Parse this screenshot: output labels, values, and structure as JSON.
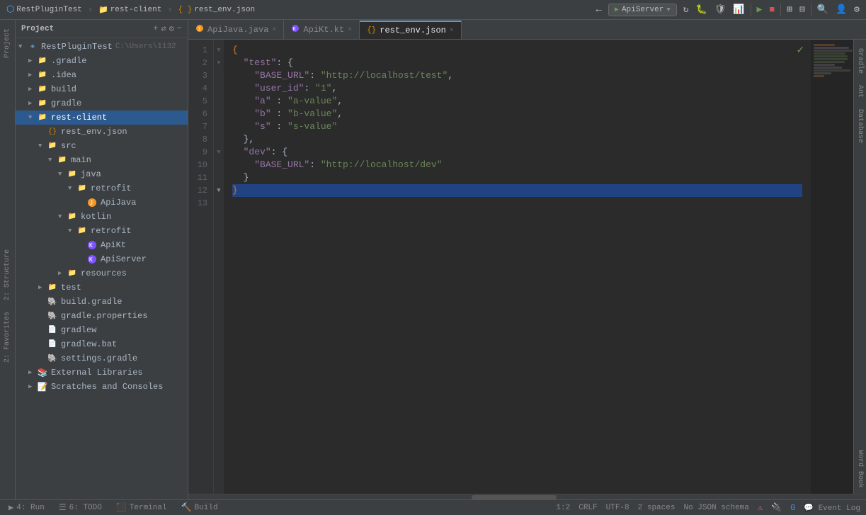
{
  "app": {
    "title": "RestPluginTest",
    "breadcrumb": [
      "RestPluginTest",
      "rest-client",
      "rest_env.json"
    ]
  },
  "toolbar": {
    "project_label": "RestPluginTest",
    "run_config": "ApiServer",
    "buttons": [
      "navigate-back",
      "navigate-forward",
      "add-icon",
      "sync-icon",
      "settings-icon",
      "minimize-icon"
    ]
  },
  "tabs": [
    {
      "id": "ApiJava",
      "label": "ApiJava.java",
      "active": false,
      "modified": false
    },
    {
      "id": "ApiKt",
      "label": "ApiKt.kt",
      "active": false,
      "modified": false
    },
    {
      "id": "rest_env",
      "label": "rest_env.json",
      "active": true,
      "modified": false
    }
  ],
  "sidebar": {
    "title": "Project",
    "items": [
      {
        "id": "root",
        "label": "RestPluginTest",
        "path": "C:\\Users\\1132",
        "indent": 0,
        "expanded": true,
        "type": "module"
      },
      {
        "id": "gradle-root",
        "label": ".gradle",
        "indent": 1,
        "expanded": false,
        "type": "folder"
      },
      {
        "id": "idea",
        "label": ".idea",
        "indent": 1,
        "expanded": false,
        "type": "folder"
      },
      {
        "id": "build-root",
        "label": "build",
        "indent": 1,
        "expanded": false,
        "type": "folder",
        "selected": false
      },
      {
        "id": "gradle",
        "label": "gradle",
        "indent": 1,
        "expanded": false,
        "type": "folder"
      },
      {
        "id": "rest-client",
        "label": "rest-client",
        "indent": 1,
        "expanded": true,
        "type": "folder",
        "selected": true
      },
      {
        "id": "rest_env_json",
        "label": "rest_env.json",
        "indent": 2,
        "expanded": false,
        "type": "json"
      },
      {
        "id": "src",
        "label": "src",
        "indent": 2,
        "expanded": true,
        "type": "folder"
      },
      {
        "id": "main",
        "label": "main",
        "indent": 3,
        "expanded": true,
        "type": "folder"
      },
      {
        "id": "java",
        "label": "java",
        "indent": 4,
        "expanded": true,
        "type": "folder"
      },
      {
        "id": "retrofit-java",
        "label": "retrofit",
        "indent": 5,
        "expanded": true,
        "type": "folder"
      },
      {
        "id": "ApiJava-file",
        "label": "ApiJava",
        "indent": 6,
        "expanded": false,
        "type": "java"
      },
      {
        "id": "kotlin",
        "label": "kotlin",
        "indent": 4,
        "expanded": true,
        "type": "folder"
      },
      {
        "id": "retrofit-kotlin",
        "label": "retrofit",
        "indent": 5,
        "expanded": true,
        "type": "folder"
      },
      {
        "id": "ApiKt-file",
        "label": "ApiKt",
        "indent": 6,
        "expanded": false,
        "type": "kotlin"
      },
      {
        "id": "ApiServer-file",
        "label": "ApiServer",
        "indent": 6,
        "expanded": false,
        "type": "kotlin"
      },
      {
        "id": "resources",
        "label": "resources",
        "indent": 4,
        "expanded": false,
        "type": "folder"
      },
      {
        "id": "test",
        "label": "test",
        "indent": 2,
        "expanded": false,
        "type": "folder"
      },
      {
        "id": "build-gradle",
        "label": "build.gradle",
        "indent": 2,
        "expanded": false,
        "type": "gradle"
      },
      {
        "id": "gradle-props",
        "label": "gradle.properties",
        "indent": 2,
        "expanded": false,
        "type": "gradle"
      },
      {
        "id": "gradlew",
        "label": "gradlew",
        "indent": 2,
        "expanded": false,
        "type": "file"
      },
      {
        "id": "gradlew-bat",
        "label": "gradlew.bat",
        "indent": 2,
        "expanded": false,
        "type": "file"
      },
      {
        "id": "settings-gradle",
        "label": "settings.gradle",
        "indent": 2,
        "expanded": false,
        "type": "gradle"
      },
      {
        "id": "external-libs",
        "label": "External Libraries",
        "indent": 1,
        "expanded": false,
        "type": "external"
      },
      {
        "id": "scratches",
        "label": "Scratches and Consoles",
        "indent": 1,
        "expanded": false,
        "type": "scratch"
      }
    ]
  },
  "editor": {
    "filename": "rest_env.json",
    "lines": [
      {
        "num": 1,
        "content": "{",
        "fold": "open"
      },
      {
        "num": 2,
        "content": "  \"test\": {",
        "fold": "open"
      },
      {
        "num": 3,
        "content": "    \"BASE_URL\": \"http://localhost/test\",",
        "fold": null
      },
      {
        "num": 4,
        "content": "    \"user_id\": \"1\",",
        "fold": null
      },
      {
        "num": 5,
        "content": "    \"a\" : \"a-value\",",
        "fold": null
      },
      {
        "num": 6,
        "content": "    \"b\" : \"b-value\",",
        "fold": null
      },
      {
        "num": 7,
        "content": "    \"s\" : \"s-value\"",
        "fold": null
      },
      {
        "num": 8,
        "content": "  },",
        "fold": null
      },
      {
        "num": 9,
        "content": "  \"dev\": {",
        "fold": "open"
      },
      {
        "num": 10,
        "content": "    \"BASE_URL\": \"http://localhost/dev\"",
        "fold": null
      },
      {
        "num": 11,
        "content": "  }",
        "fold": null
      },
      {
        "num": 12,
        "content": "}",
        "fold": "close"
      },
      {
        "num": 13,
        "content": "",
        "fold": null
      }
    ]
  },
  "status_bar": {
    "position": "1:2",
    "line_ending": "CRLF",
    "encoding": "UTF-8",
    "indent": "2 spaces",
    "schema": "No JSON schema",
    "event_log": "Event Log"
  },
  "bottom_tabs": [
    {
      "id": "run",
      "label": "4: Run",
      "icon": "▶"
    },
    {
      "id": "todo",
      "label": "6: TODO",
      "icon": "☰"
    },
    {
      "id": "terminal",
      "label": "Terminal",
      "icon": "⬛"
    },
    {
      "id": "build",
      "label": "Build",
      "icon": "🔨"
    }
  ],
  "right_panels": [
    "Gradle",
    "Ant",
    "Database",
    "Word Book"
  ],
  "left_panels": [
    "Structure",
    "Favorites"
  ]
}
